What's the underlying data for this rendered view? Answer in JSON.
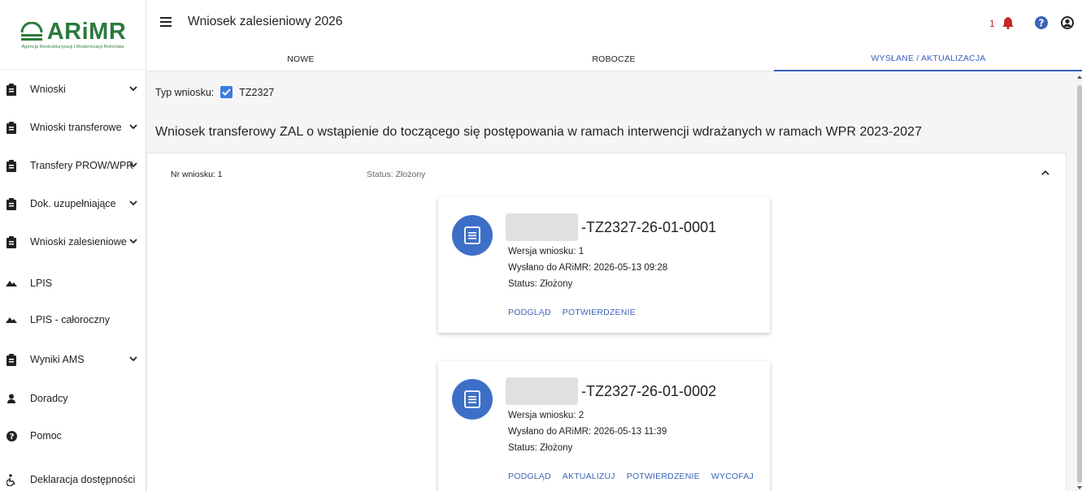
{
  "logo": {
    "name": "ARiMR",
    "subtitle": "Agencja Restrukturyzacji i Modernizacji Rolnictwa"
  },
  "header": {
    "title": "Wniosek zalesieniowy 2026",
    "notification_count": "1"
  },
  "tabs": [
    {
      "label": "NOWE",
      "active": false
    },
    {
      "label": "ROBOCZE",
      "active": false
    },
    {
      "label": "WYSŁANE / AKTUALIZACJA",
      "active": true
    }
  ],
  "sidebar": {
    "items": [
      {
        "label": "Wnioski",
        "icon": "clipboard-icon",
        "chevron": true
      },
      {
        "label": "Wnioski transferowe",
        "icon": "clipboard-icon",
        "chevron": true
      },
      {
        "label": "Transfery PROW/WPR",
        "icon": "clipboard-icon",
        "chevron": true
      },
      {
        "label": "Dok. uzupełniające",
        "icon": "clipboard-icon",
        "chevron": true
      },
      {
        "label": "Wnioski zalesieniowe",
        "icon": "clipboard-icon",
        "chevron": true
      },
      {
        "label": "LPIS",
        "icon": "terrain-icon",
        "chevron": false
      },
      {
        "label": "LPIS - całoroczny",
        "icon": "terrain-icon",
        "chevron": false
      },
      {
        "label": "Wyniki AMS",
        "icon": "clipboard-icon",
        "chevron": true
      },
      {
        "label": "Doradcy",
        "icon": "person-icon",
        "chevron": false
      },
      {
        "label": "Pomoc",
        "icon": "help-icon",
        "chevron": false
      },
      {
        "label": "Deklaracja dostępności",
        "icon": "accessibility-icon",
        "chevron": false
      }
    ]
  },
  "filter": {
    "label": "Typ wniosku:",
    "checkbox_label": "TZ2327",
    "checked": true
  },
  "section_title": "Wniosek transferowy ZAL o wstąpienie do toczącego się postępowania w ramach interwencji wdrażanych w ramach WPR 2023-2027",
  "panel": {
    "number": "Nr wniosku: 1",
    "status": "Status: Złożony"
  },
  "cards": [
    {
      "number": "-TZ2327-26-01-0001",
      "version": "Wersja wniosku: 1",
      "sent": "Wysłano do ARiMR: 2026-05-13 09:28",
      "status": "Status: Złożony",
      "actions": [
        "PODGLĄD",
        "POTWIERDZENIE"
      ]
    },
    {
      "number": "-TZ2327-26-01-0002",
      "version": "Wersja wniosku: 2",
      "sent": "Wysłano do ARiMR: 2026-05-13 11:39",
      "status": "Status: Złożony",
      "actions": [
        "PODGLĄD",
        "AKTUALIZUJ",
        "POTWIERDZENIE",
        "WYCOFAJ"
      ]
    }
  ],
  "colors": {
    "accent": "#3b63b8",
    "brand_green": "#2b7a3d",
    "doc_icon_bg": "#3d6fc7",
    "notification": "#c62828"
  }
}
